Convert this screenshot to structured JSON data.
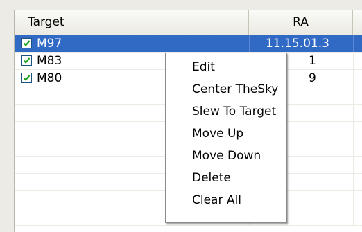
{
  "grid": {
    "columns": [
      "Target",
      "RA"
    ],
    "rows": [
      {
        "target": "M97",
        "ra": "11.15.01.3",
        "checked": true,
        "selected": true
      },
      {
        "target": "M83",
        "ra": "1",
        "checked": true,
        "selected": false
      },
      {
        "target": "M80",
        "ra": "9",
        "checked": true,
        "selected": false
      }
    ]
  },
  "context_menu": {
    "items": [
      "Edit",
      "Center TheSky",
      "Slew To Target",
      "Move Up",
      "Move Down",
      "Delete",
      "Clear All"
    ]
  },
  "colors": {
    "selection": "#316ac5",
    "checkmark": "#21a121"
  }
}
